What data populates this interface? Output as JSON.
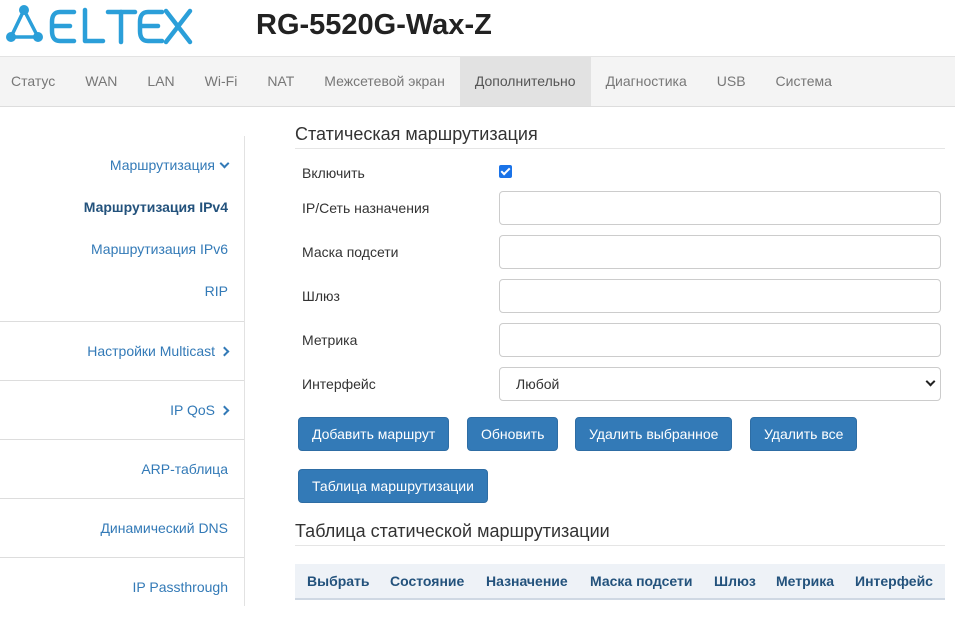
{
  "header": {
    "brand": "ELTEX",
    "model": "RG-5520G-Wax-Z"
  },
  "nav": {
    "items": [
      {
        "label": "Статус"
      },
      {
        "label": "WAN"
      },
      {
        "label": "LAN"
      },
      {
        "label": "Wi-Fi"
      },
      {
        "label": "NAT"
      },
      {
        "label": "Межсетевой экран"
      },
      {
        "label": "Дополнительно",
        "active": true
      },
      {
        "label": "Диагностика"
      },
      {
        "label": "USB"
      },
      {
        "label": "Система"
      }
    ]
  },
  "sidebar": {
    "routing": "Маршрутизация",
    "routing_ipv4": "Маршрутизация IPv4",
    "routing_ipv6": "Маршрутизация IPv6",
    "rip": "RIP",
    "multicast": "Настройки Multicast",
    "qos": "IP QoS",
    "arp": "ARP-таблица",
    "ddns": "Динамический DNS",
    "passthrough": "IP Passthrough"
  },
  "form": {
    "title": "Статическая маршрутизация",
    "enable_label": "Включить",
    "enable_checked": true,
    "destination_label": "IP/Сеть назначения",
    "destination_value": "",
    "mask_label": "Маска подсети",
    "mask_value": "",
    "gateway_label": "Шлюз",
    "gateway_value": "",
    "metric_label": "Метрика",
    "metric_value": "",
    "interface_label": "Интерфейс",
    "interface_value": "Любой"
  },
  "buttons": {
    "add": "Добавить маршрут",
    "refresh": "Обновить",
    "delete_selected": "Удалить выбранное",
    "delete_all": "Удалить все",
    "routing_table": "Таблица маршрутизации"
  },
  "table": {
    "title": "Таблица статической маршрутизации",
    "columns": [
      "Выбрать",
      "Состояние",
      "Назначение",
      "Маска подсети",
      "Шлюз",
      "Метрика",
      "Интерфейс"
    ]
  },
  "colors": {
    "brand": "#2b9fd9",
    "primary_button": "#337ab7",
    "link": "#337ab7"
  }
}
